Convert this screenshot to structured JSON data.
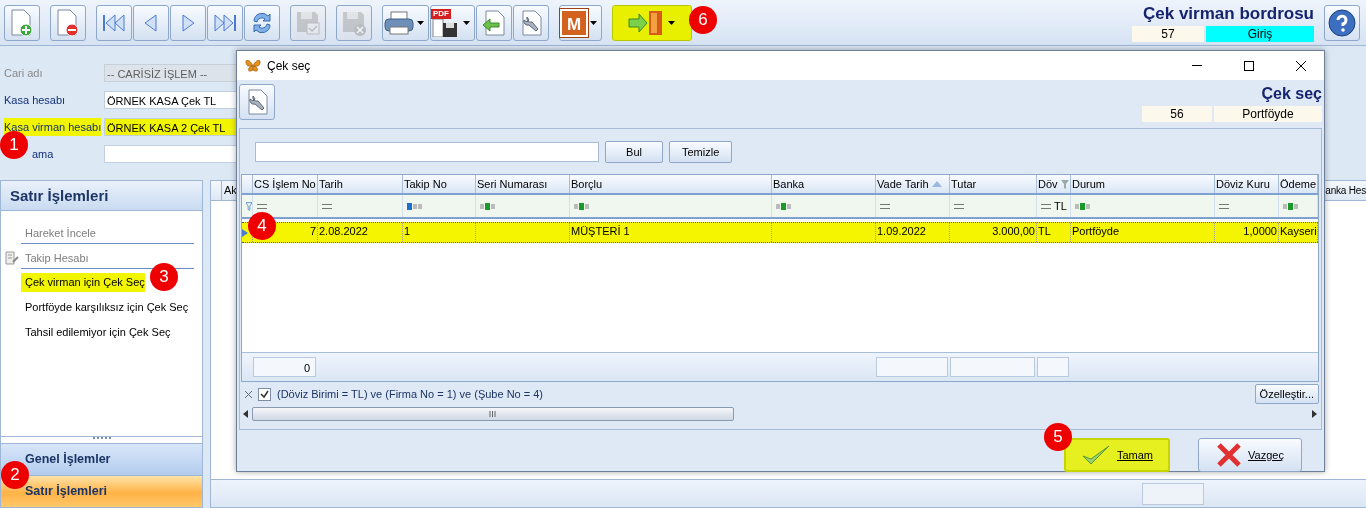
{
  "toolbar": {
    "groups": [
      [
        {
          "kind": "new",
          "disabled": false,
          "highlighted": false
        }
      ],
      [
        {
          "kind": "delete",
          "disabled": false,
          "highlighted": false
        }
      ],
      [
        {
          "kind": "first",
          "disabled": false,
          "highlighted": false
        },
        {
          "kind": "prev",
          "disabled": false,
          "highlighted": false
        },
        {
          "kind": "next",
          "disabled": false,
          "highlighted": false
        },
        {
          "kind": "last",
          "disabled": false,
          "highlighted": false
        },
        {
          "kind": "refresh",
          "disabled": false,
          "highlighted": false
        }
      ],
      [
        {
          "kind": "save",
          "disabled": true,
          "highlighted": false
        }
      ],
      [
        {
          "kind": "save_cancel",
          "disabled": true,
          "highlighted": false
        }
      ],
      [
        {
          "kind": "print",
          "disabled": false,
          "highlighted": false,
          "dropdown": true
        },
        {
          "kind": "pdf",
          "label": "PDF",
          "disabled": false,
          "highlighted": false,
          "dropdown": true
        },
        {
          "kind": "import",
          "disabled": false,
          "highlighted": false
        },
        {
          "kind": "tools",
          "disabled": false,
          "highlighted": false
        }
      ],
      [
        {
          "kind": "letter",
          "label": "M",
          "disabled": false,
          "highlighted": false,
          "dropdown": true
        }
      ],
      [
        {
          "kind": "exit",
          "disabled": false,
          "highlighted": true,
          "dropdown": true
        }
      ]
    ]
  },
  "header": {
    "title": "Çek virman bordrosu",
    "number": "57",
    "status": "Giriş"
  },
  "form": {
    "fields": [
      {
        "label": "Cari adı",
        "value": "-- CARİSİZ İŞLEM --",
        "disabled": true,
        "highlighted": false
      },
      {
        "label": "Kasa hesabı",
        "value": "ÖRNEK KASA Çek TL",
        "disabled": false,
        "highlighted": false
      },
      {
        "label": "Kasa virman hesabı",
        "value": "ÖRNEK KASA 2 Çek TL",
        "disabled": false,
        "highlighted": true
      },
      {
        "label": "ama",
        "disabled": false,
        "highlighted": false
      }
    ]
  },
  "sidebar": {
    "title": "Satır İşlemleri",
    "items": [
      {
        "label": "Hareket İncele",
        "disabled": true,
        "highlighted": false,
        "divider": true
      },
      {
        "label": "Takip Hesabı",
        "disabled": true,
        "highlighted": false,
        "icon": true,
        "divider": true
      },
      {
        "label": "Çek virman için Çek Seç",
        "disabled": false,
        "highlighted": true,
        "divider": false
      },
      {
        "label": "Portföyde karşılıksız için Çek Seç",
        "disabled": false,
        "highlighted": false,
        "divider": false
      },
      {
        "label": "Tahsil edilemiyor için Çek Seç",
        "disabled": false,
        "highlighted": false,
        "divider": false
      }
    ],
    "groups": [
      {
        "label": "Genel İşlemler",
        "selected": false
      },
      {
        "label": "Satır İşlemleri",
        "selected": true
      }
    ]
  },
  "grid": {
    "columns": [
      "Ak",
      "anka Hes"
    ]
  },
  "dialog": {
    "title": "Çek seç",
    "heading": "Çek seç",
    "number": "56",
    "status": "Portföyde",
    "search": {
      "buttons": [
        "Bul",
        "Temizle"
      ]
    },
    "table": {
      "columns": [
        {
          "label": "CS İşlem No",
          "filter": {
            "kind": "equals"
          },
          "kind": "number",
          "footer": true
        },
        {
          "label": "Tarih",
          "filter": {
            "kind": "equals"
          },
          "kind": "text"
        },
        {
          "label": "Takip No",
          "filter": {
            "kind": "starts"
          },
          "kind": "text"
        },
        {
          "label": "Seri Numarası",
          "filter": {
            "kind": "contains"
          },
          "kind": "text"
        },
        {
          "label": "Borçlu",
          "filter": {
            "kind": "contains"
          },
          "kind": "text"
        },
        {
          "label": "Banka",
          "filter": {
            "kind": "contains"
          },
          "kind": "text"
        },
        {
          "label": "Vade Tarih",
          "filter": {
            "kind": "equals"
          },
          "kind": "text",
          "footer": true,
          "sorted": true
        },
        {
          "label": "Tutar",
          "filter": {
            "kind": "equals"
          },
          "kind": "number",
          "footer": true
        },
        {
          "label": "Döv",
          "filter": {
            "kind": "equals",
            "value": "TL"
          },
          "kind": "text",
          "footer": true,
          "filtered": true
        },
        {
          "label": "Durum",
          "filter": {
            "kind": "contains"
          },
          "kind": "text"
        },
        {
          "label": "Döviz Kuru",
          "filter": {
            "kind": "equals"
          },
          "kind": "number"
        },
        {
          "label": "Ödeme",
          "filter": {
            "kind": "contains"
          },
          "kind": "text"
        }
      ],
      "rows": [
        {
          "selected": true,
          "cells": [
            "7",
            "2.08.2022",
            "1",
            null,
            "MÜŞTERİ 1",
            null,
            "1.09.2022",
            "3.000,00",
            "TL",
            "Portföyde",
            "1,0000",
            "Kayseri"
          ]
        }
      ],
      "footer_value": "0"
    },
    "filter": {
      "checked": true,
      "text": "(Döviz Birimi = TL) ve (Firma No = 1) ve (Şube No = 4)",
      "button": "Özelleştir..."
    },
    "buttons": [
      {
        "label": "Tamam",
        "kind": "ok",
        "highlighted": true
      },
      {
        "label": "Vazgeç",
        "kind": "cancel",
        "highlighted": false
      }
    ]
  },
  "annotations": [
    "1",
    "2",
    "3",
    "4",
    "5",
    "6"
  ]
}
